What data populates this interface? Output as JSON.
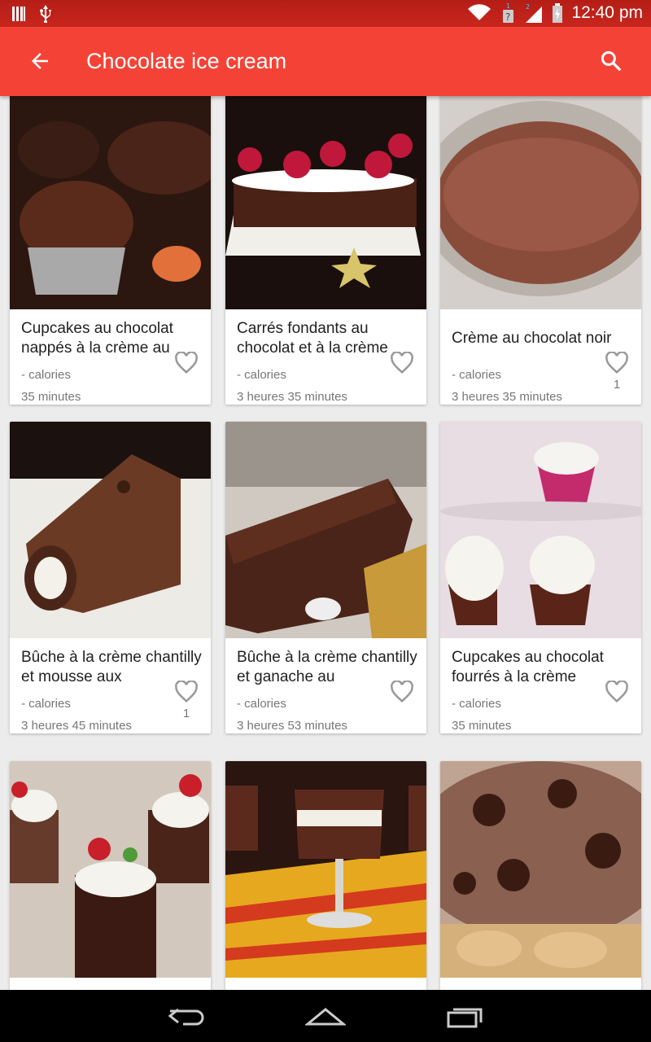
{
  "status_bar": {
    "time": "12:40 pm"
  },
  "app_bar": {
    "title": "Chocolate ice cream"
  },
  "recipes": [
    {
      "title": "Cupcakes au chocolat nappés à la crème au",
      "calories": "- calories",
      "time": "35 minutes",
      "likes": ""
    },
    {
      "title": "Carrés fondants au chocolat et à la crème",
      "calories": "- calories",
      "time": "3 heures 35 minutes",
      "likes": ""
    },
    {
      "title": "Crème au chocolat noir",
      "calories": "- calories",
      "time": "3 heures 35 minutes",
      "likes": "1"
    },
    {
      "title": "Bûche à la crème chantilly et mousse aux",
      "calories": "- calories",
      "time": "3 heures 45 minutes",
      "likes": "1"
    },
    {
      "title": "Bûche à la crème chantilly et ganache au",
      "calories": "- calories",
      "time": "3 heures 53 minutes",
      "likes": ""
    },
    {
      "title": "Cupcakes au chocolat fourrés à la crème",
      "calories": "- calories",
      "time": "35 minutes",
      "likes": ""
    },
    {
      "title": "",
      "calories": "",
      "time": "",
      "likes": ""
    },
    {
      "title": "",
      "calories": "",
      "time": "",
      "likes": ""
    },
    {
      "title": "",
      "calories": "",
      "time": "",
      "likes": ""
    }
  ],
  "colors": {
    "primary": "#f44336",
    "status_bar": "#c8261d"
  }
}
